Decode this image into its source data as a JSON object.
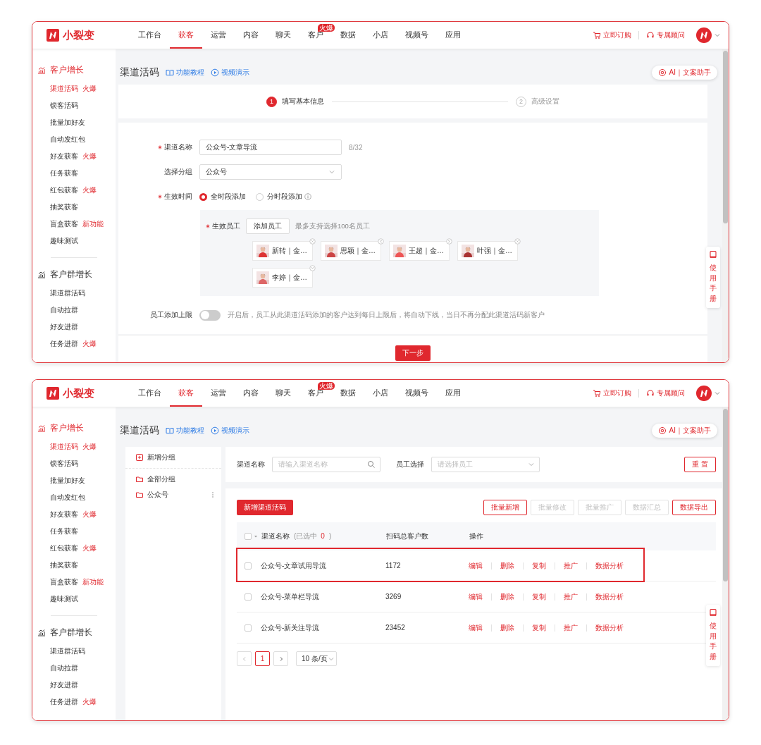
{
  "screens": [
    {
      "nav": {
        "brand": "小裂变",
        "tabs": [
          {
            "label": "工作台",
            "selected": false
          },
          {
            "label": "获客",
            "selected": true
          },
          {
            "label": "运营",
            "selected": false
          },
          {
            "label": "内容",
            "selected": false
          },
          {
            "label": "聊天",
            "selected": false
          },
          {
            "label": "客户",
            "selected": false,
            "badge": "火爆"
          },
          {
            "label": "数据",
            "selected": false
          },
          {
            "label": "小店",
            "selected": false
          },
          {
            "label": "视频号",
            "selected": false
          },
          {
            "label": "应用",
            "selected": false
          }
        ],
        "actions": [
          {
            "label": "立即订购",
            "kind": "cart"
          },
          {
            "label": "专属顾问",
            "kind": "headset"
          }
        ]
      },
      "sidebar": [
        {
          "title": "客户增长",
          "selected": true,
          "items": [
            {
              "label": "渠道活码",
              "badge": "火爆",
              "selected": true
            },
            {
              "label": "锁客活码",
              "selected": false
            },
            {
              "label": "批量加好友",
              "selected": false
            },
            {
              "label": "自动发红包",
              "selected": false
            },
            {
              "label": "好友获客",
              "badge": "火爆",
              "selected": false
            },
            {
              "label": "任务获客",
              "selected": false
            },
            {
              "label": "红包获客",
              "badge": "火爆",
              "selected": false
            },
            {
              "label": "抽奖获客",
              "selected": false
            },
            {
              "label": "盲盒获客",
              "badge": "新功能",
              "selected": false
            },
            {
              "label": "趣味测试",
              "selected": false
            }
          ]
        },
        {
          "title": "客户群增长",
          "selected": false,
          "items": [
            {
              "label": "渠道群活码",
              "selected": false
            },
            {
              "label": "自动拉群",
              "selected": false
            },
            {
              "label": "好友进群",
              "selected": false
            },
            {
              "label": "任务进群",
              "badge": "火爆",
              "selected": false
            }
          ]
        }
      ],
      "header": {
        "title": "渠道活码",
        "links": [
          {
            "label": "功能教程",
            "kind": "book"
          },
          {
            "label": "视频演示",
            "kind": "play"
          }
        ],
        "assistant": "AI｜文案助手"
      },
      "help_tab": "使用手册",
      "page": {
        "kind": "form",
        "steps": [
          {
            "number": "1",
            "label": "填写基本信息",
            "selected": true
          },
          {
            "number": "2",
            "label": "高级设置",
            "selected": false
          }
        ],
        "name_field": {
          "label": "渠道名称",
          "required": true,
          "value": "公众号-文章导流",
          "counter": "8/32"
        },
        "group_field": {
          "label": "选择分组",
          "value": "公众号"
        },
        "time_field": {
          "label": "生效时间",
          "required": true,
          "options": [
            {
              "label": "全时段添加",
              "selected": true,
              "info": false
            },
            {
              "label": "分时段添加",
              "selected": false,
              "info": true
            }
          ]
        },
        "staff": {
          "label": "生效员工",
          "required": true,
          "button": "添加员工",
          "hint": "最多支持选择100名员工",
          "members": [
            "新转｜金…",
            "思颖｜金…",
            "王超｜金…",
            "叶强｜金…",
            "李婷｜金…"
          ]
        },
        "limit": {
          "label": "员工添加上限",
          "on": false,
          "hint": "开启后，员工从此渠道活码添加的客户达到每日上限后，将自动下线，当日不再分配此渠道活码新客户"
        },
        "next_button": "下一步"
      }
    },
    {
      "nav": {
        "brand": "小裂变",
        "tabs": [
          {
            "label": "工作台",
            "selected": false
          },
          {
            "label": "获客",
            "selected": true
          },
          {
            "label": "运营",
            "selected": false
          },
          {
            "label": "内容",
            "selected": false
          },
          {
            "label": "聊天",
            "selected": false
          },
          {
            "label": "客户",
            "selected": false,
            "badge": "火爆"
          },
          {
            "label": "数据",
            "selected": false
          },
          {
            "label": "小店",
            "selected": false
          },
          {
            "label": "视频号",
            "selected": false
          },
          {
            "label": "应用",
            "selected": false
          }
        ],
        "actions": [
          {
            "label": "立即订购",
            "kind": "cart"
          },
          {
            "label": "专属顾问",
            "kind": "headset"
          }
        ]
      },
      "sidebar": [
        {
          "title": "客户增长",
          "selected": true,
          "items": [
            {
              "label": "渠道活码",
              "badge": "火爆",
              "selected": true
            },
            {
              "label": "锁客活码",
              "selected": false
            },
            {
              "label": "批量加好友",
              "selected": false
            },
            {
              "label": "自动发红包",
              "selected": false
            },
            {
              "label": "好友获客",
              "badge": "火爆",
              "selected": false
            },
            {
              "label": "任务获客",
              "selected": false
            },
            {
              "label": "红包获客",
              "badge": "火爆",
              "selected": false
            },
            {
              "label": "抽奖获客",
              "selected": false
            },
            {
              "label": "盲盒获客",
              "badge": "新功能",
              "selected": false
            },
            {
              "label": "趣味测试",
              "selected": false
            }
          ]
        },
        {
          "title": "客户群增长",
          "selected": false,
          "items": [
            {
              "label": "渠道群活码",
              "selected": false
            },
            {
              "label": "自动拉群",
              "selected": false
            },
            {
              "label": "好友进群",
              "selected": false
            },
            {
              "label": "任务进群",
              "badge": "火爆",
              "selected": false
            }
          ]
        }
      ],
      "header": {
        "title": "渠道活码",
        "links": [
          {
            "label": "功能教程",
            "kind": "book"
          },
          {
            "label": "视频演示",
            "kind": "play"
          }
        ],
        "assistant": "AI｜文案助手"
      },
      "help_tab": "使用手册",
      "page": {
        "kind": "list",
        "groups_panel": {
          "add": "新增分组",
          "groups": [
            {
              "label": "全部分组",
              "menu": false
            },
            {
              "label": "公众号",
              "menu": true
            }
          ]
        },
        "filters": {
          "name_label": "渠道名称",
          "name_placeholder": "请输入渠道名称",
          "staff_label": "员工选择",
          "staff_placeholder": "请选择员工",
          "reset": "重 置"
        },
        "create_button": "新增渠道活码",
        "toolbar": [
          {
            "label": "批量新增",
            "disabled": false
          },
          {
            "label": "批量修改",
            "disabled": true
          },
          {
            "label": "批量推广",
            "disabled": true
          },
          {
            "label": "数据汇总",
            "disabled": true
          },
          {
            "label": "数据导出",
            "disabled": false
          }
        ],
        "table": {
          "columns": [
            "渠道名称",
            "扫码总客户数",
            "操作"
          ],
          "selection": {
            "checked": false,
            "prefix": "(已选中",
            "count": "0",
            "suffix": ")"
          },
          "rows": [
            {
              "name": "公众号-文章试用导流",
              "scans": "1172",
              "checked": false,
              "highlighted": true,
              "actions": [
                "编辑",
                "删除",
                "复制",
                "推广",
                "数据分析"
              ]
            },
            {
              "name": "公众号-菜单栏导流",
              "scans": "3269",
              "checked": false,
              "actions": [
                "编辑",
                "删除",
                "复制",
                "推广",
                "数据分析"
              ]
            },
            {
              "name": "公众号-新关注导流",
              "scans": "23452",
              "checked": false,
              "actions": [
                "编辑",
                "删除",
                "复制",
                "推广",
                "数据分析"
              ]
            }
          ]
        },
        "pagination": {
          "pages": [
            {
              "label": "1",
              "selected": true
            }
          ],
          "page_size": "10 条/页"
        }
      }
    }
  ]
}
